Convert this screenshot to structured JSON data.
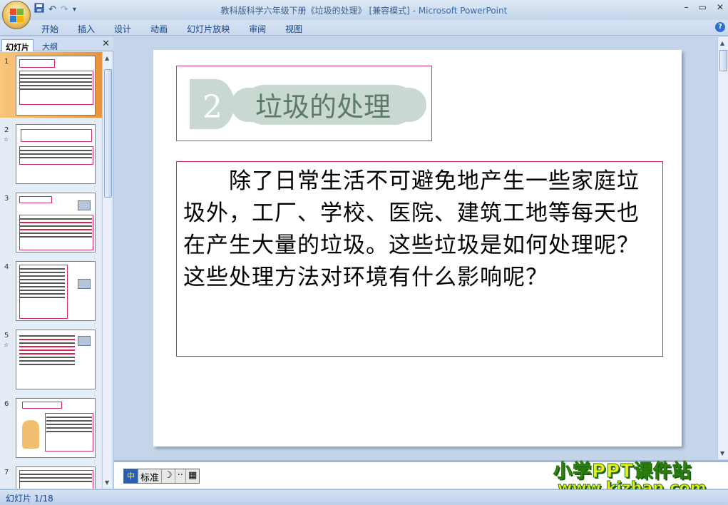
{
  "window": {
    "title": "教科版科学六年级下册《垃圾的处理》 [兼容模式] - ",
    "app_name": "Microsoft PowerPoint",
    "controls": [
      "–",
      "▭",
      "✕"
    ]
  },
  "quick_access": {
    "save_icon": "save-icon",
    "undo": "↶",
    "redo": "↷",
    "customize": "▾"
  },
  "ribbon": {
    "tabs": [
      "开始",
      "插入",
      "设计",
      "动画",
      "幻灯片放映",
      "审阅",
      "视图"
    ],
    "help": "?"
  },
  "panel": {
    "tab_slides": "幻灯片",
    "tab_outline": "大纲",
    "close": "✕",
    "thumbnails": [
      {
        "num": "1",
        "star": ""
      },
      {
        "num": "2",
        "star": "☆"
      },
      {
        "num": "3",
        "star": ""
      },
      {
        "num": "4",
        "star": ""
      },
      {
        "num": "5",
        "star": "☆"
      },
      {
        "num": "6",
        "star": ""
      },
      {
        "num": "7",
        "star": ""
      }
    ]
  },
  "slide": {
    "badge_number": "2",
    "badge_title": "垃圾的处理",
    "body": "除了日常生活不可避免地产生一些家庭垃圾外，工厂、学校、医院、建筑工地等每天也在产生大量的垃圾。这些垃圾是如何处理呢？这些处理方法对环境有什么影响呢？"
  },
  "ime": {
    "mode": "标准",
    "moon": "☽",
    "dots": "··",
    "keyboard": "▦"
  },
  "watermark": {
    "line1": "小学PPT课件站",
    "line2": "www.kjzhan.com"
  },
  "status": {
    "slide_counter": "幻灯片 1/18"
  },
  "colors": {
    "frame_border": "#d63a72",
    "badge_fill": "#c9d8d0",
    "badge_text": "#5d7a6a",
    "watermark_fill": "#f3ec17",
    "selected_thumb": "#e8933a"
  }
}
